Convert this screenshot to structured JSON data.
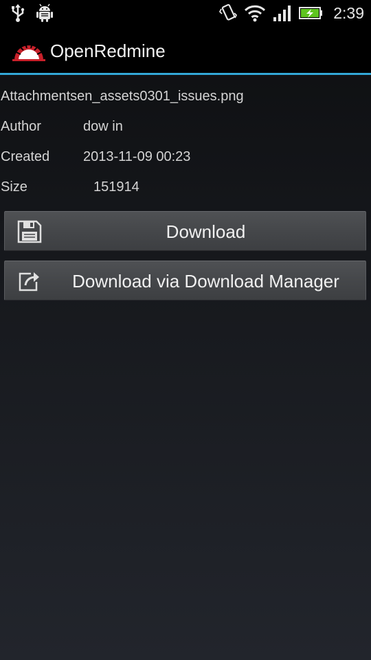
{
  "status_bar": {
    "time": "2:39",
    "icons": [
      "usb-icon",
      "android-debug-icon",
      "vibrate-icon",
      "wifi-icon",
      "signal-icon",
      "battery-charging-icon"
    ]
  },
  "action_bar": {
    "title": "OpenRedmine",
    "logo_icon": "redmine-logo-icon",
    "accent_color": "#33a8d8"
  },
  "attachment": {
    "file_name": "Attachmentsen_assets0301_issues.png",
    "fields": [
      {
        "label": "Author",
        "value": "dow in"
      },
      {
        "label": "Created",
        "value": "2013-11-09 00:23"
      },
      {
        "label": "Size",
        "value": "151914"
      }
    ]
  },
  "actions": [
    {
      "label": "Download",
      "icon": "save-icon"
    },
    {
      "label": "Download via Download Manager",
      "icon": "share-icon"
    }
  ]
}
